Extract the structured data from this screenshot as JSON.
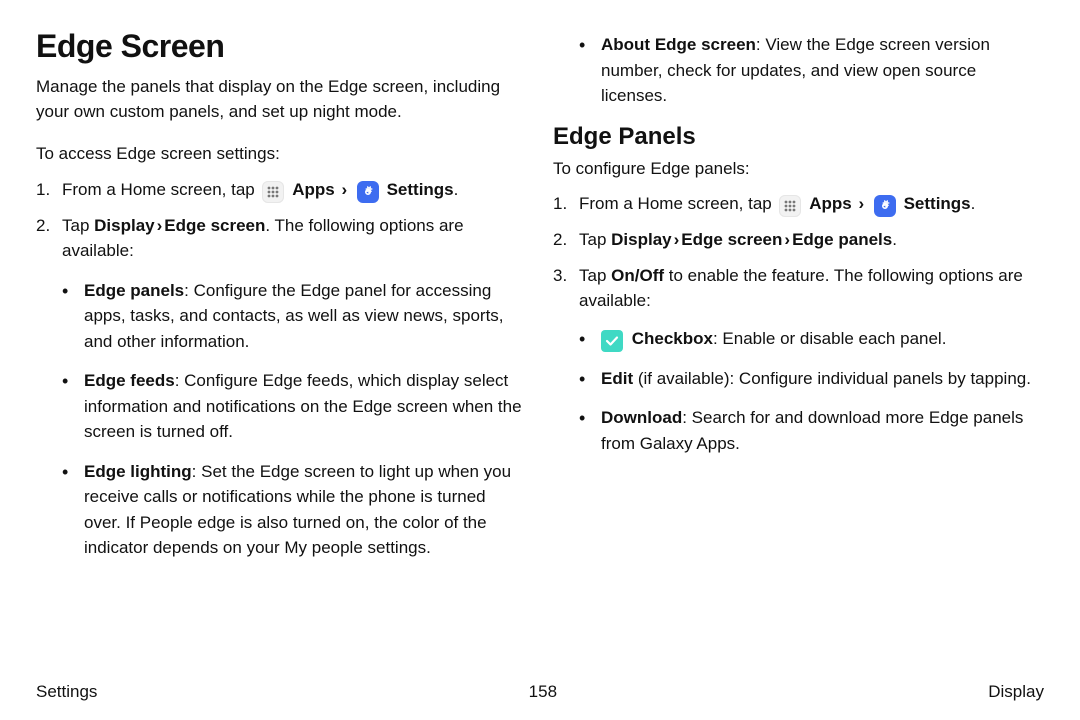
{
  "left": {
    "heading": "Edge Screen",
    "intro": "Manage the panels that display on the Edge screen, including your own custom panels, and set up night mode.",
    "lead": "To access Edge screen settings:",
    "step1_prefix": "From a Home screen, tap ",
    "apps_label": "Apps",
    "chevron": "›",
    "settings_label": "Settings",
    "period": ".",
    "step2_a": "Tap ",
    "step2_b": "Display",
    "step2_c": "Edge screen",
    "step2_d": ". The following options are available:",
    "opt1_title": "Edge panels",
    "opt1_body": ": Configure the Edge panel for accessing apps, tasks, and contacts, as well as view news, sports, and other information.",
    "opt2_title": "Edge feeds",
    "opt2_body": ": Configure Edge feeds, which display select information and notifications on the Edge screen when the screen is turned off.",
    "opt3_title": "Edge lighting",
    "opt3_body": ": Set the Edge screen to light up when you receive calls or notifications while the phone is turned over. If People edge is also turned on, the color of the indicator depends on your My people settings."
  },
  "right": {
    "cont_title": "About Edge screen",
    "cont_body": ": View the Edge screen version number, check for updates, and view open source licenses.",
    "heading": "Edge Panels",
    "lead": "To configure Edge panels:",
    "step1_prefix": "From a Home screen, tap ",
    "apps_label": "Apps",
    "chevron": "›",
    "settings_label": "Settings",
    "period": ".",
    "step2_a": "Tap ",
    "step2_b": "Display",
    "step2_c": "Edge screen",
    "step2_d": "Edge panels",
    "step2_e": ".",
    "step3_a": "Tap ",
    "step3_b": "On/Off",
    "step3_c": " to enable the feature. The following options are available:",
    "opt1_title": "Checkbox",
    "opt1_body": ": Enable or disable each panel.",
    "opt2_title": "Edit",
    "opt2_mid": " (if available): Configure individual panels by tapping.",
    "opt3_title": "Download",
    "opt3_body": ": Search for and download more Edge panels from Galaxy Apps."
  },
  "footer": {
    "left": "Settings",
    "center": "158",
    "right": "Display"
  }
}
